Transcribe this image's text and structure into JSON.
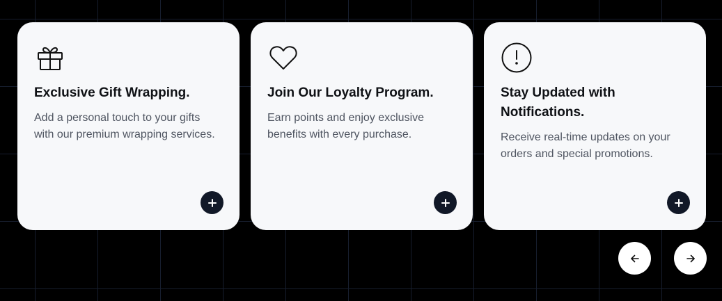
{
  "cards": [
    {
      "icon": "gift-icon",
      "title": "Exclusive Gift Wrapping.",
      "description": "Add a personal touch to your gifts with our premium wrapping services.",
      "action": "plus-icon"
    },
    {
      "icon": "heart-icon",
      "title": "Join Our Loyalty Program.",
      "description": "Earn points and enjoy exclusive benefits with every purchase.",
      "action": "plus-icon"
    },
    {
      "icon": "alert-circle-icon",
      "title": "Stay Updated with Notifications.",
      "description": "Receive real-time updates on your orders and special promotions.",
      "action": "plus-icon"
    }
  ],
  "navigation": {
    "prev_icon": "arrow-left-icon",
    "next_icon": "arrow-right-icon"
  },
  "colors": {
    "page_background": "#000000",
    "card_background": "#f7f8fa",
    "title_text": "#0f1115",
    "body_text": "#4f5561",
    "action_button": "#111827",
    "nav_button": "#ffffff"
  }
}
